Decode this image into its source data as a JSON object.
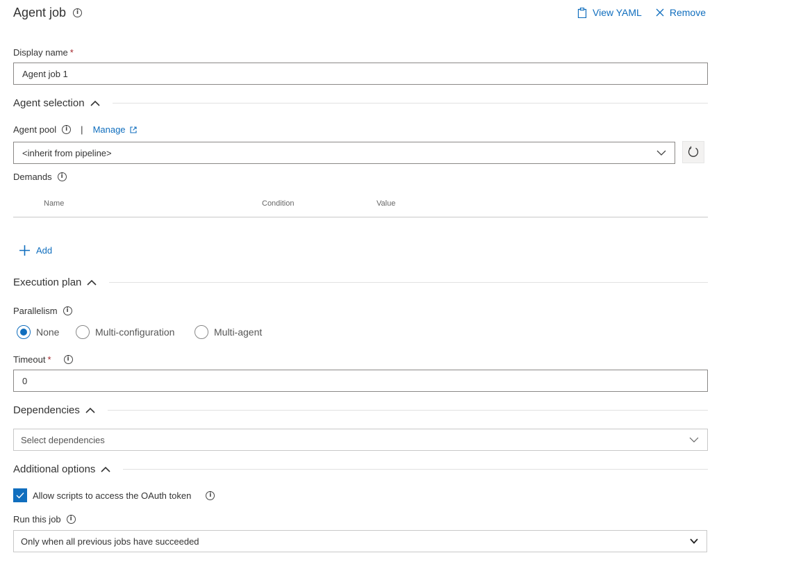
{
  "header": {
    "title": "Agent job",
    "view_yaml": "View YAML",
    "remove": "Remove"
  },
  "display_name": {
    "label": "Display name",
    "required": "*",
    "value": "Agent job 1"
  },
  "agent_selection": {
    "title": "Agent selection",
    "pool_label": "Agent pool",
    "separator": "|",
    "manage": "Manage",
    "pool_value": "<inherit from pipeline>",
    "demands_label": "Demands",
    "columns": [
      "Name",
      "Condition",
      "Value"
    ],
    "add": "Add"
  },
  "execution_plan": {
    "title": "Execution plan",
    "parallelism_label": "Parallelism",
    "options": [
      "None",
      "Multi-configuration",
      "Multi-agent"
    ],
    "selected": "None",
    "timeout_label": "Timeout",
    "timeout_required": "*",
    "timeout_value": "0"
  },
  "dependencies": {
    "title": "Dependencies",
    "placeholder": "Select dependencies"
  },
  "additional_options": {
    "title": "Additional options",
    "oauth_label": "Allow scripts to access the OAuth token",
    "oauth_checked": true,
    "run_label": "Run this job",
    "run_value": "Only when all previous jobs have succeeded"
  },
  "colors": {
    "accent": "#106ebe",
    "required": "#a4262c"
  }
}
